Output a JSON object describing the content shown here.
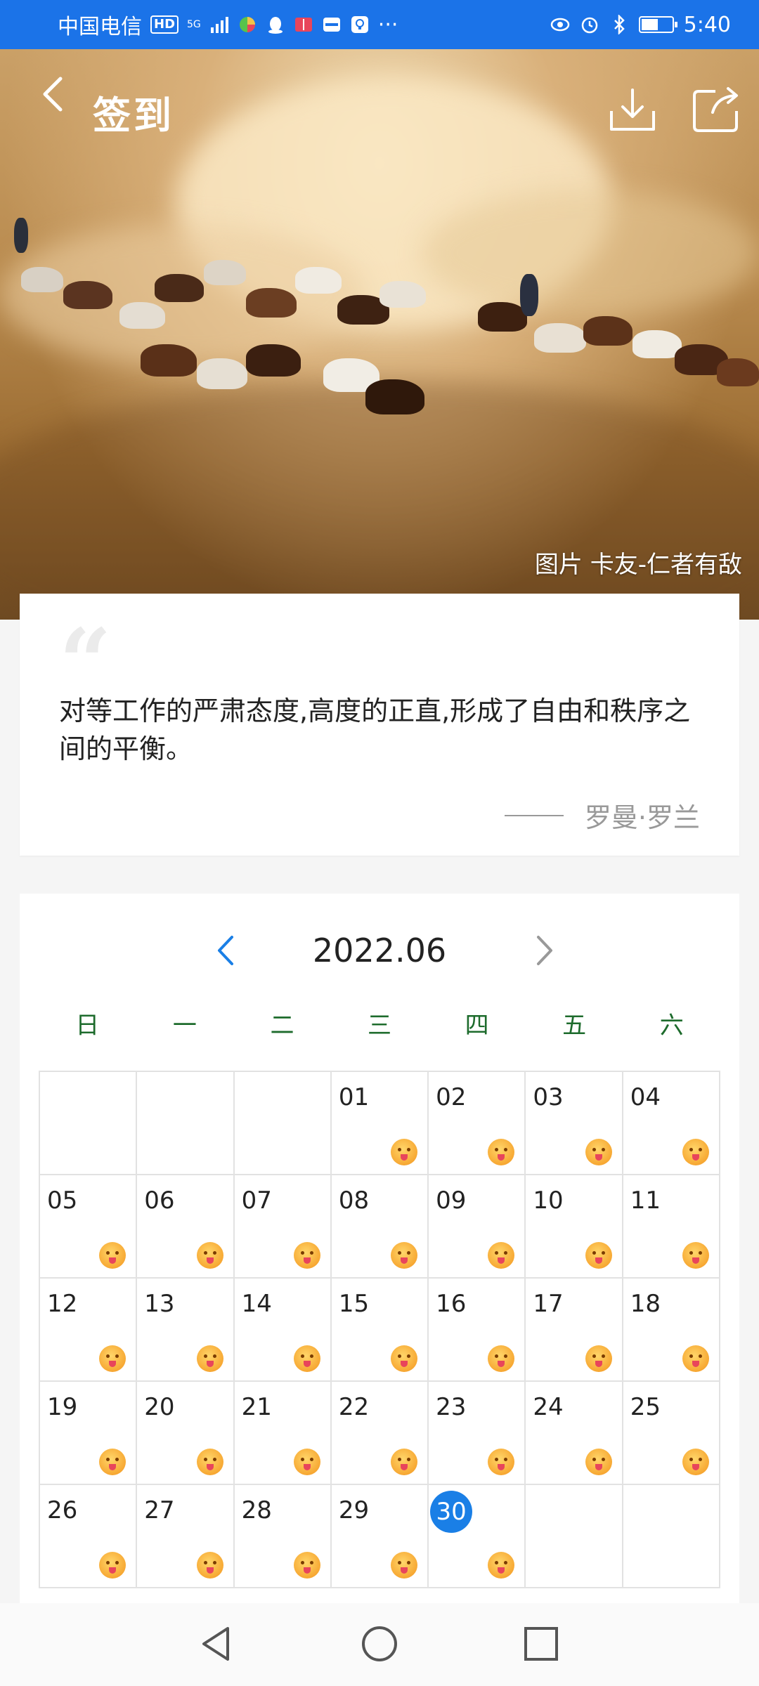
{
  "status_bar": {
    "carrier": "中国电信",
    "hd_badge": "HD",
    "network": "5G",
    "time": "5:40",
    "battery_level": 0.55
  },
  "header": {
    "title": "签到",
    "back_icon": "chevron-left-icon",
    "download_icon": "download-icon",
    "share_icon": "share-icon"
  },
  "hero": {
    "credit": "图片 卡友-仁者有敌"
  },
  "quote": {
    "mark": "“",
    "text": "对等工作的严肃态度,高度的正直,形成了自由和秩序之间的平衡。",
    "author": "罗曼·罗兰"
  },
  "calendar": {
    "month": "2022.06",
    "weekdays": [
      "日",
      "一",
      "二",
      "三",
      "四",
      "五",
      "六"
    ],
    "today": "30",
    "accent": "#1a7fe6",
    "days": [
      "",
      "",
      "",
      "01",
      "02",
      "03",
      "04",
      "05",
      "06",
      "07",
      "08",
      "09",
      "10",
      "11",
      "12",
      "13",
      "14",
      "15",
      "16",
      "17",
      "18",
      "19",
      "20",
      "21",
      "22",
      "23",
      "24",
      "25",
      "26",
      "27",
      "28",
      "29",
      "30",
      "",
      ""
    ],
    "checked_icon": "face-emoji-icon"
  },
  "nav_bar": {
    "back_icon": "triangle-back-icon",
    "home_icon": "circle-home-icon",
    "recents_icon": "square-recents-icon"
  }
}
